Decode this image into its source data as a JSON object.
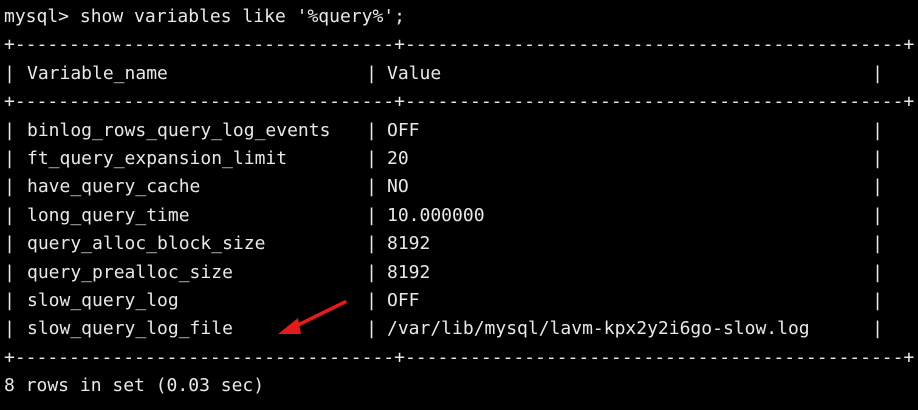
{
  "terminal": {
    "prompt": "mysql>",
    "command": "show variables like '%query%';",
    "border": "+-----------------------------------+----------------------------------------------+",
    "columns": {
      "name": "Variable_name",
      "value": "Value"
    },
    "rows": [
      {
        "name": "binlog_rows_query_log_events",
        "value": "OFF"
      },
      {
        "name": "ft_query_expansion_limit",
        "value": "20"
      },
      {
        "name": "have_query_cache",
        "value": "NO"
      },
      {
        "name": "long_query_time",
        "value": "10.000000"
      },
      {
        "name": "query_alloc_block_size",
        "value": "8192"
      },
      {
        "name": "query_prealloc_size",
        "value": "8192"
      },
      {
        "name": "slow_query_log",
        "value": "OFF"
      },
      {
        "name": "slow_query_log_file",
        "value": "/var/lib/mysql/lavm-kpx2y2i6go-slow.log"
      }
    ],
    "result_summary": "8 rows in set (0.03 sec)"
  },
  "annotation": {
    "icon": "red-arrow-icon",
    "color": "#e31b1b"
  }
}
